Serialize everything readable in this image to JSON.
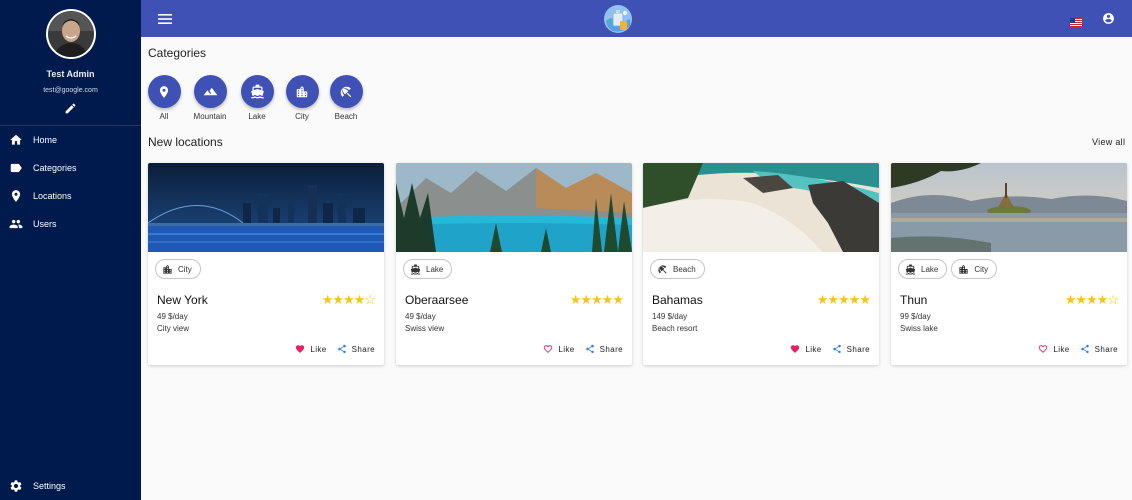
{
  "sidebar": {
    "profile": {
      "name": "Test Admin",
      "email": "test@google.com"
    },
    "items": [
      {
        "label": "Home",
        "icon": "home-icon"
      },
      {
        "label": "Categories",
        "icon": "label-icon"
      },
      {
        "label": "Locations",
        "icon": "location-pin-icon"
      },
      {
        "label": "Users",
        "icon": "users-icon"
      }
    ],
    "settings": {
      "label": "Settings",
      "icon": "gear-icon"
    }
  },
  "topbar": {
    "menu_icon": "menu-icon",
    "language_icon": "us-flag-icon",
    "account_icon": "account-circle-icon"
  },
  "categories": {
    "title": "Categories",
    "items": [
      {
        "label": "All",
        "icon": "location-pin-icon"
      },
      {
        "label": "Mountain",
        "icon": "mountain-icon"
      },
      {
        "label": "Lake",
        "icon": "boat-icon"
      },
      {
        "label": "City",
        "icon": "city-icon"
      },
      {
        "label": "Beach",
        "icon": "beach-umbrella-icon"
      }
    ]
  },
  "new_locations": {
    "title": "New locations",
    "view_all": "View all",
    "cards": [
      {
        "title": "New York",
        "price": "49 $/day",
        "description": "City view",
        "rating": 4,
        "chips": [
          "City"
        ],
        "liked": true,
        "like_label": "Like",
        "share_label": "Share"
      },
      {
        "title": "Oberaarsee",
        "price": "49 $/day",
        "description": "Swiss view",
        "rating": 5,
        "chips": [
          "Lake"
        ],
        "liked": false,
        "like_label": "Like",
        "share_label": "Share"
      },
      {
        "title": "Bahamas",
        "price": "149 $/day",
        "description": "Beach resort",
        "rating": 5,
        "chips": [
          "Beach"
        ],
        "liked": true,
        "like_label": "Like",
        "share_label": "Share"
      },
      {
        "title": "Thun",
        "price": "99 $/day",
        "description": "Swiss lake",
        "rating": 4,
        "chips": [
          "Lake",
          "City"
        ],
        "liked": false,
        "like_label": "Like",
        "share_label": "Share"
      }
    ]
  },
  "colors": {
    "sidebar": "#001a4d",
    "primary": "#3f51b5",
    "star": "#f5c518",
    "heart": "#e91e63",
    "share": "#2979ff"
  }
}
